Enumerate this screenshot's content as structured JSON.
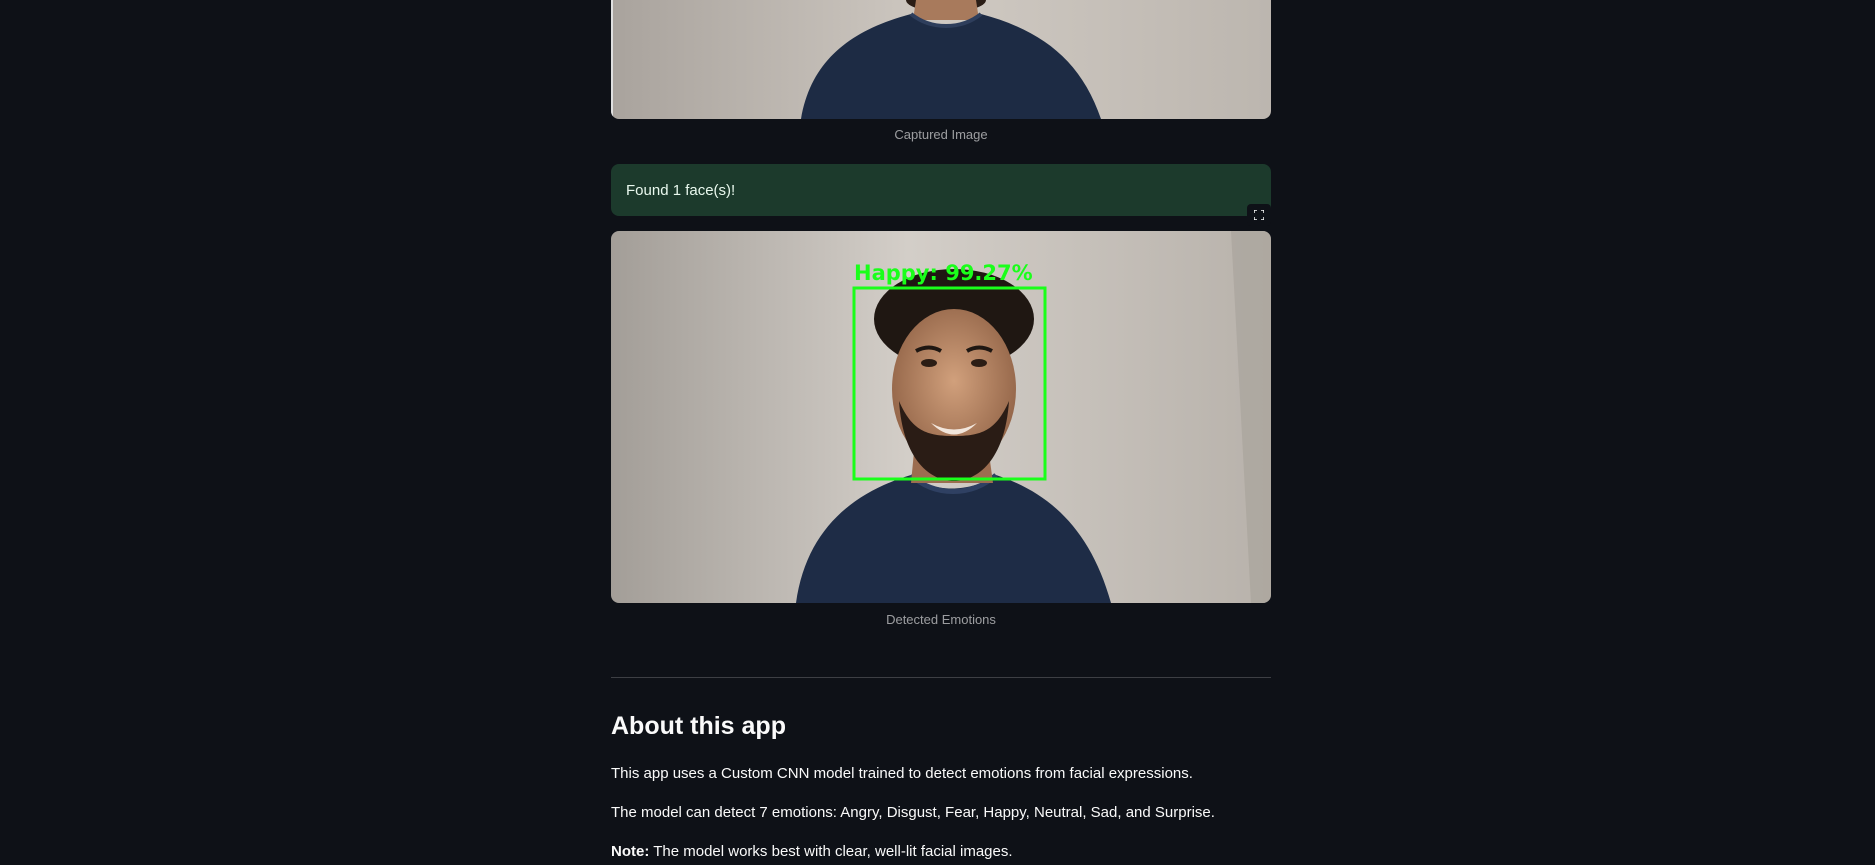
{
  "captured": {
    "caption": "Captured Image"
  },
  "alert": {
    "message": "Found 1 face(s)!"
  },
  "detected": {
    "label": "Happy:  99.27%",
    "caption": "Detected Emotions"
  },
  "about": {
    "heading": "About this app",
    "para1": "This app uses a Custom CNN model trained to detect emotions from facial expressions.",
    "para2": "The model can detect 7 emotions: Angry, Disgust, Fear, Happy, Neutral, Sad, and Surprise.",
    "note_label": "Note:",
    "note_text": " The model works best with clear, well-lit facial images."
  },
  "colors": {
    "background": "#0e1117",
    "success_bg": "#1c3a2c",
    "box_green": "#1aff1a"
  },
  "icons": [
    "fullscreen-icon"
  ]
}
